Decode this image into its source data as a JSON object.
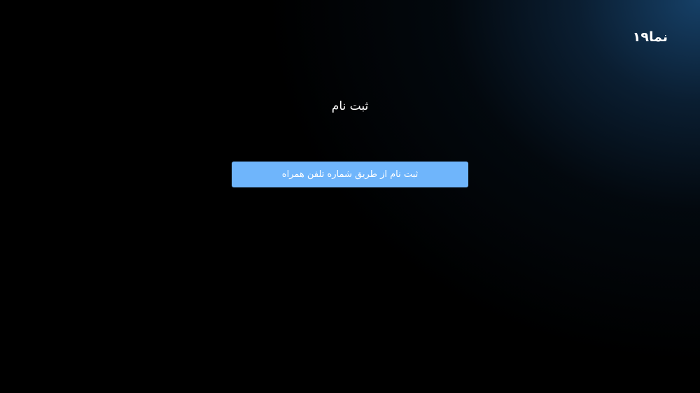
{
  "brand": {
    "logo_text": "نما۱۹"
  },
  "page": {
    "title": "ثبت نام"
  },
  "actions": {
    "signup_phone_label": "ثبت نام از طریق شماره تلفن همراه"
  },
  "colors": {
    "background": "#000000",
    "glow": "#17436c",
    "button": "#6fb5fb",
    "text": "#ffffff"
  }
}
